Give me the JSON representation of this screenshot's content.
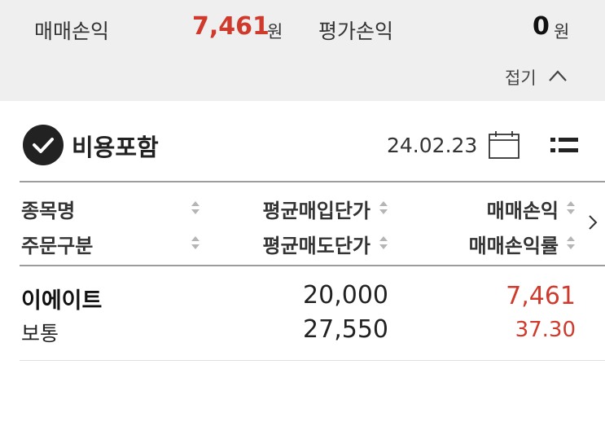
{
  "colors": {
    "profit": "#cf3a2c",
    "panel": "#efefef"
  },
  "summary": {
    "trade_pl_label": "매매손익",
    "trade_pl_value": "7,461",
    "trade_pl_unit": "원",
    "eval_pl_label": "평가손익",
    "eval_pl_value": "0",
    "eval_pl_unit": "원",
    "fold_label": "접기",
    "fold_icon": "chevron-up-icon"
  },
  "toolbar": {
    "cost_label": "비용포함",
    "cost_checked": true,
    "date": "24.02.23",
    "calendar_icon": "calendar-icon",
    "list_icon": "list-icon"
  },
  "table": {
    "headers": {
      "col1_top": "종목명",
      "col1_bottom": "주문구분",
      "col2_top": "평균매입단가",
      "col2_bottom": "평균매도단가",
      "col3_top": "매매손익",
      "col3_bottom": "매매손익률"
    },
    "rows": [
      {
        "name": "이에이트",
        "order_type": "보통",
        "avg_buy_price": "20,000",
        "avg_sell_price": "27,550",
        "trade_pl": "7,461",
        "trade_pl_rate": "37.30"
      }
    ]
  }
}
